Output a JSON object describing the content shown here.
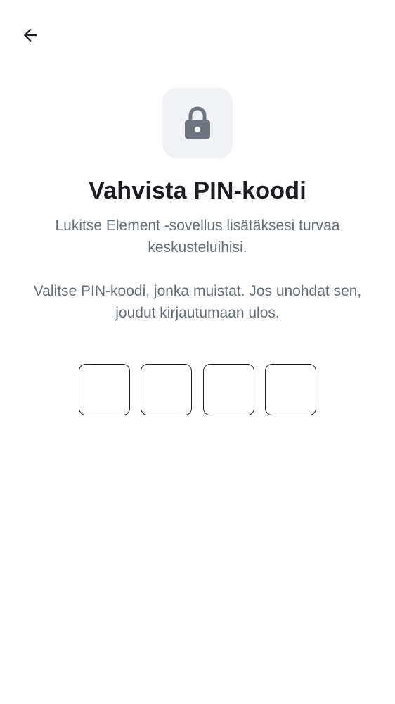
{
  "header": {
    "back_icon": "arrow-left-icon"
  },
  "hero": {
    "icon": "lock-icon",
    "title": "Vahvista PIN-koodi",
    "description_1": "Lukitse Element -sovellus lisätäksesi turvaa keskusteluihisi.",
    "description_2": "Valitse PIN-koodi, jonka muistat. Jos unohdat sen, joudut kirjautumaan ulos."
  },
  "pin": {
    "digits": [
      "",
      "",
      "",
      ""
    ]
  },
  "colors": {
    "text_primary": "#1b1d22",
    "text_secondary": "#656d77",
    "tile_background": "#f0f2f5",
    "icon_gray": "#6e7580"
  }
}
